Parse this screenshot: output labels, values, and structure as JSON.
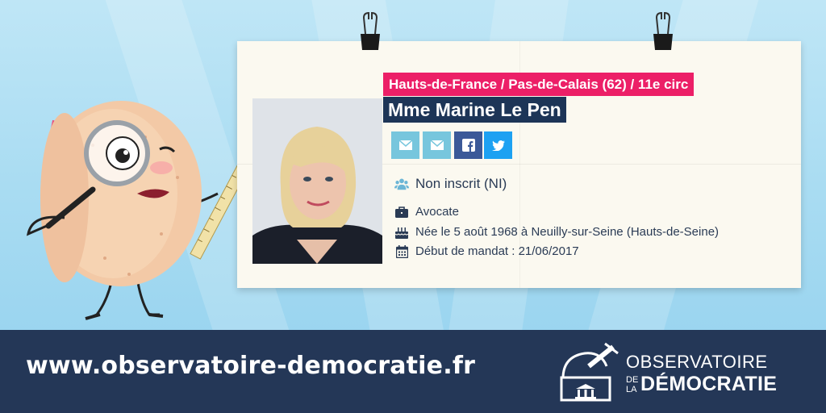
{
  "deputy": {
    "circonscription": "Hauts-de-France / Pas-de-Calais (62) / 11e circ",
    "name": "Mme Marine Le Pen",
    "group": "Non inscrit (NI)",
    "profession": "Avocate",
    "birth": "Née le 5 août 1968 à Neuilly-sur-Seine (Hauts-de-Seine)",
    "mandate_start": "Début de mandat : 21/06/2017"
  },
  "social_buttons": [
    {
      "icon": "mail-icon",
      "color": "#77c6dd"
    },
    {
      "icon": "mail-icon",
      "color": "#77c6dd"
    },
    {
      "icon": "facebook-icon",
      "color": "#3b5998"
    },
    {
      "icon": "twitter-icon",
      "color": "#1da1f2"
    }
  ],
  "info_icons": {
    "group": "users-icon",
    "profession": "briefcase-icon",
    "birth": "birthday-cake-icon",
    "mandate": "calendar-icon"
  },
  "footer": {
    "url": "www.observatoire-democratie.fr",
    "logo_line1": "OBSERVATOIRE",
    "logo_de": "DE",
    "logo_la": "LA",
    "logo_line2": "DÉMOCRATIE"
  },
  "colors": {
    "accent_pink": "#ec1f67",
    "navy": "#1d3557",
    "footer_bg": "#243757",
    "background": "#a9dcf2"
  }
}
